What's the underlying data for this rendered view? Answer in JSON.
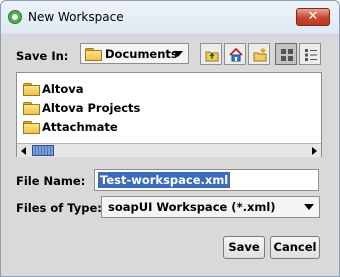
{
  "window": {
    "title": "New Workspace",
    "close_glyph": "✕"
  },
  "save_in": {
    "label": "Save In:",
    "value": "Documents",
    "toolbar": [
      "up-one-level-icon",
      "home-icon",
      "new-folder-icon",
      "list-view-icon",
      "details-view-icon"
    ]
  },
  "files": [
    {
      "name": "Altova",
      "icon": "folder-icon"
    },
    {
      "name": "Altova Projects",
      "icon": "folder-icon"
    },
    {
      "name": "Attachmate",
      "icon": "folder-icon"
    }
  ],
  "file_name": {
    "label": "File Name:",
    "value": "Test-workspace.xml"
  },
  "files_of_type": {
    "label": "Files of Type:",
    "value": "soapUI Workspace (*.xml)"
  },
  "buttons": {
    "save": "Save",
    "cancel": "Cancel"
  },
  "colors": {
    "selection": "#3c6bb8",
    "close_button": "#c8452f",
    "dialog_bg": "#d9d9d9"
  }
}
